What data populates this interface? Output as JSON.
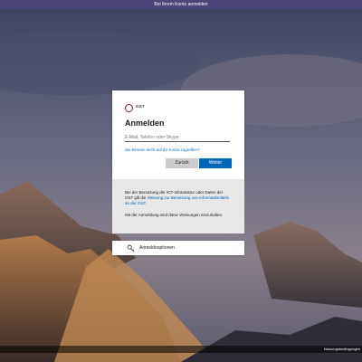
{
  "window": {
    "title": "Bei Ihrem Konto anmelden"
  },
  "signin": {
    "logo_text": "OST",
    "heading": "Anmelden",
    "email_placeholder": "E-Mail, Telefon oder Skype",
    "email_value": "",
    "cant_access_link": "Sie können nicht auf Ihr Konto zugreifen?",
    "back_button": "Zurück",
    "next_button": "Weiter"
  },
  "notice": {
    "text_before_link": "Bei der Benutzung der ICT-Infrastuktur oder Daten der OST gilt die ",
    "link": "Weisung zur Benutzung von Informatikmitteln an der OST",
    "text_after_link": ".",
    "agreement": "Mit der Anmeldung sind diese Weisungen einzuhalten."
  },
  "signin_options": {
    "label": "Anmeldeoptionen",
    "icon": "key-icon"
  },
  "footer": {
    "terms_link": "Nutzungsbedingungen"
  },
  "colors": {
    "titlebar": "#4b4577",
    "primary_button": "#0067b8",
    "secondary_button": "#cccccc",
    "link": "#0067b8",
    "logo_accent": "#7a1f3d"
  }
}
